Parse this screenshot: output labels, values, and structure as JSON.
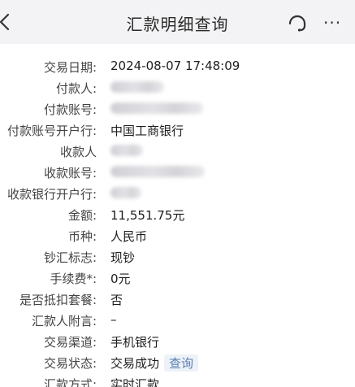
{
  "header": {
    "title": "汇款明细查询",
    "more_label": "···"
  },
  "details": {
    "trade_date": {
      "label": "交易日期:",
      "value": "2024-08-07 17:48:09"
    },
    "payer": {
      "label": "付款人:"
    },
    "payer_account": {
      "label": "付款账号:"
    },
    "payer_bank": {
      "label": "付款账号开户行:",
      "value": "中国工商银行"
    },
    "payee": {
      "label": "收款人"
    },
    "payee_account": {
      "label": "收款账号:"
    },
    "payee_bank": {
      "label": "收款银行开户行:"
    },
    "amount": {
      "label": "金额:",
      "value": "11,551.75元"
    },
    "currency": {
      "label": "币种:",
      "value": "人民币"
    },
    "cash_flag": {
      "label": "钞汇标志:",
      "value": "现钞"
    },
    "fee": {
      "label": "手续费*:",
      "value": "0元"
    },
    "package_deduct": {
      "label": "是否抵扣套餐:",
      "value": "否"
    },
    "remitter_note": {
      "label": "汇款人附言:",
      "value": "–"
    },
    "channel": {
      "label": "交易渠道:",
      "value": "手机银行"
    },
    "status": {
      "label": "交易状态:",
      "value": "交易成功",
      "query_link": "查询"
    },
    "method": {
      "label": "汇款方式:",
      "value": "实时汇款"
    }
  },
  "colors": {
    "header_bg": "#f3f3f5",
    "link": "#5a7fb0"
  }
}
